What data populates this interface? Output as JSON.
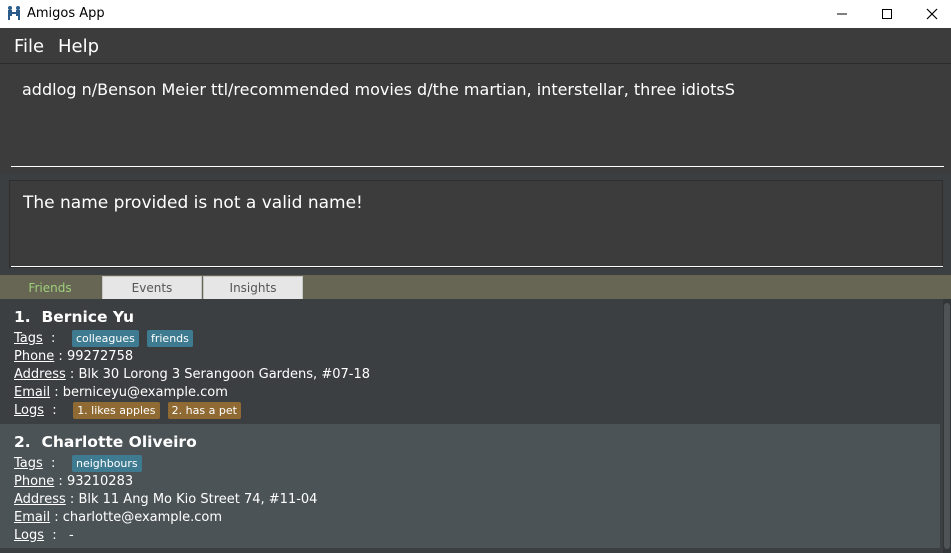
{
  "window": {
    "title": "Amigos App",
    "icon": "amigos-app-icon"
  },
  "menu": [
    "File",
    "Help"
  ],
  "command": {
    "value": "addlog n/Benson Meier ttl/recommended movies d/the martian, interstellar, three idiotsS"
  },
  "result": {
    "text": "The name provided is not a valid name!"
  },
  "tabs": [
    {
      "label": "Friends",
      "active": true
    },
    {
      "label": "Events",
      "active": false
    },
    {
      "label": "Insights",
      "active": false
    }
  ],
  "colors": {
    "accent_tab_text": "#9ed07a",
    "tag": "#3e7b91",
    "log": "#8f6a33"
  },
  "labels": {
    "tags": "Tags",
    "phone": "Phone",
    "address": "Address",
    "email": "Email",
    "logs": "Logs"
  },
  "friends": [
    {
      "index": "1.",
      "name": "Bernice Yu",
      "tags": [
        "colleagues",
        "friends"
      ],
      "phone": "99272758",
      "address": "Blk 30 Lorong 3 Serangoon Gardens, #07-18",
      "email": "berniceyu@example.com",
      "logs": [
        "1. likes apples",
        "2. has a pet"
      ],
      "logs_empty": ""
    },
    {
      "index": "2.",
      "name": "Charlotte Oliveiro",
      "tags": [
        "neighbours"
      ],
      "phone": "93210283",
      "address": "Blk 11 Ang Mo Kio Street 74, #11-04",
      "email": "charlotte@example.com",
      "logs": [],
      "logs_empty": "-"
    }
  ]
}
